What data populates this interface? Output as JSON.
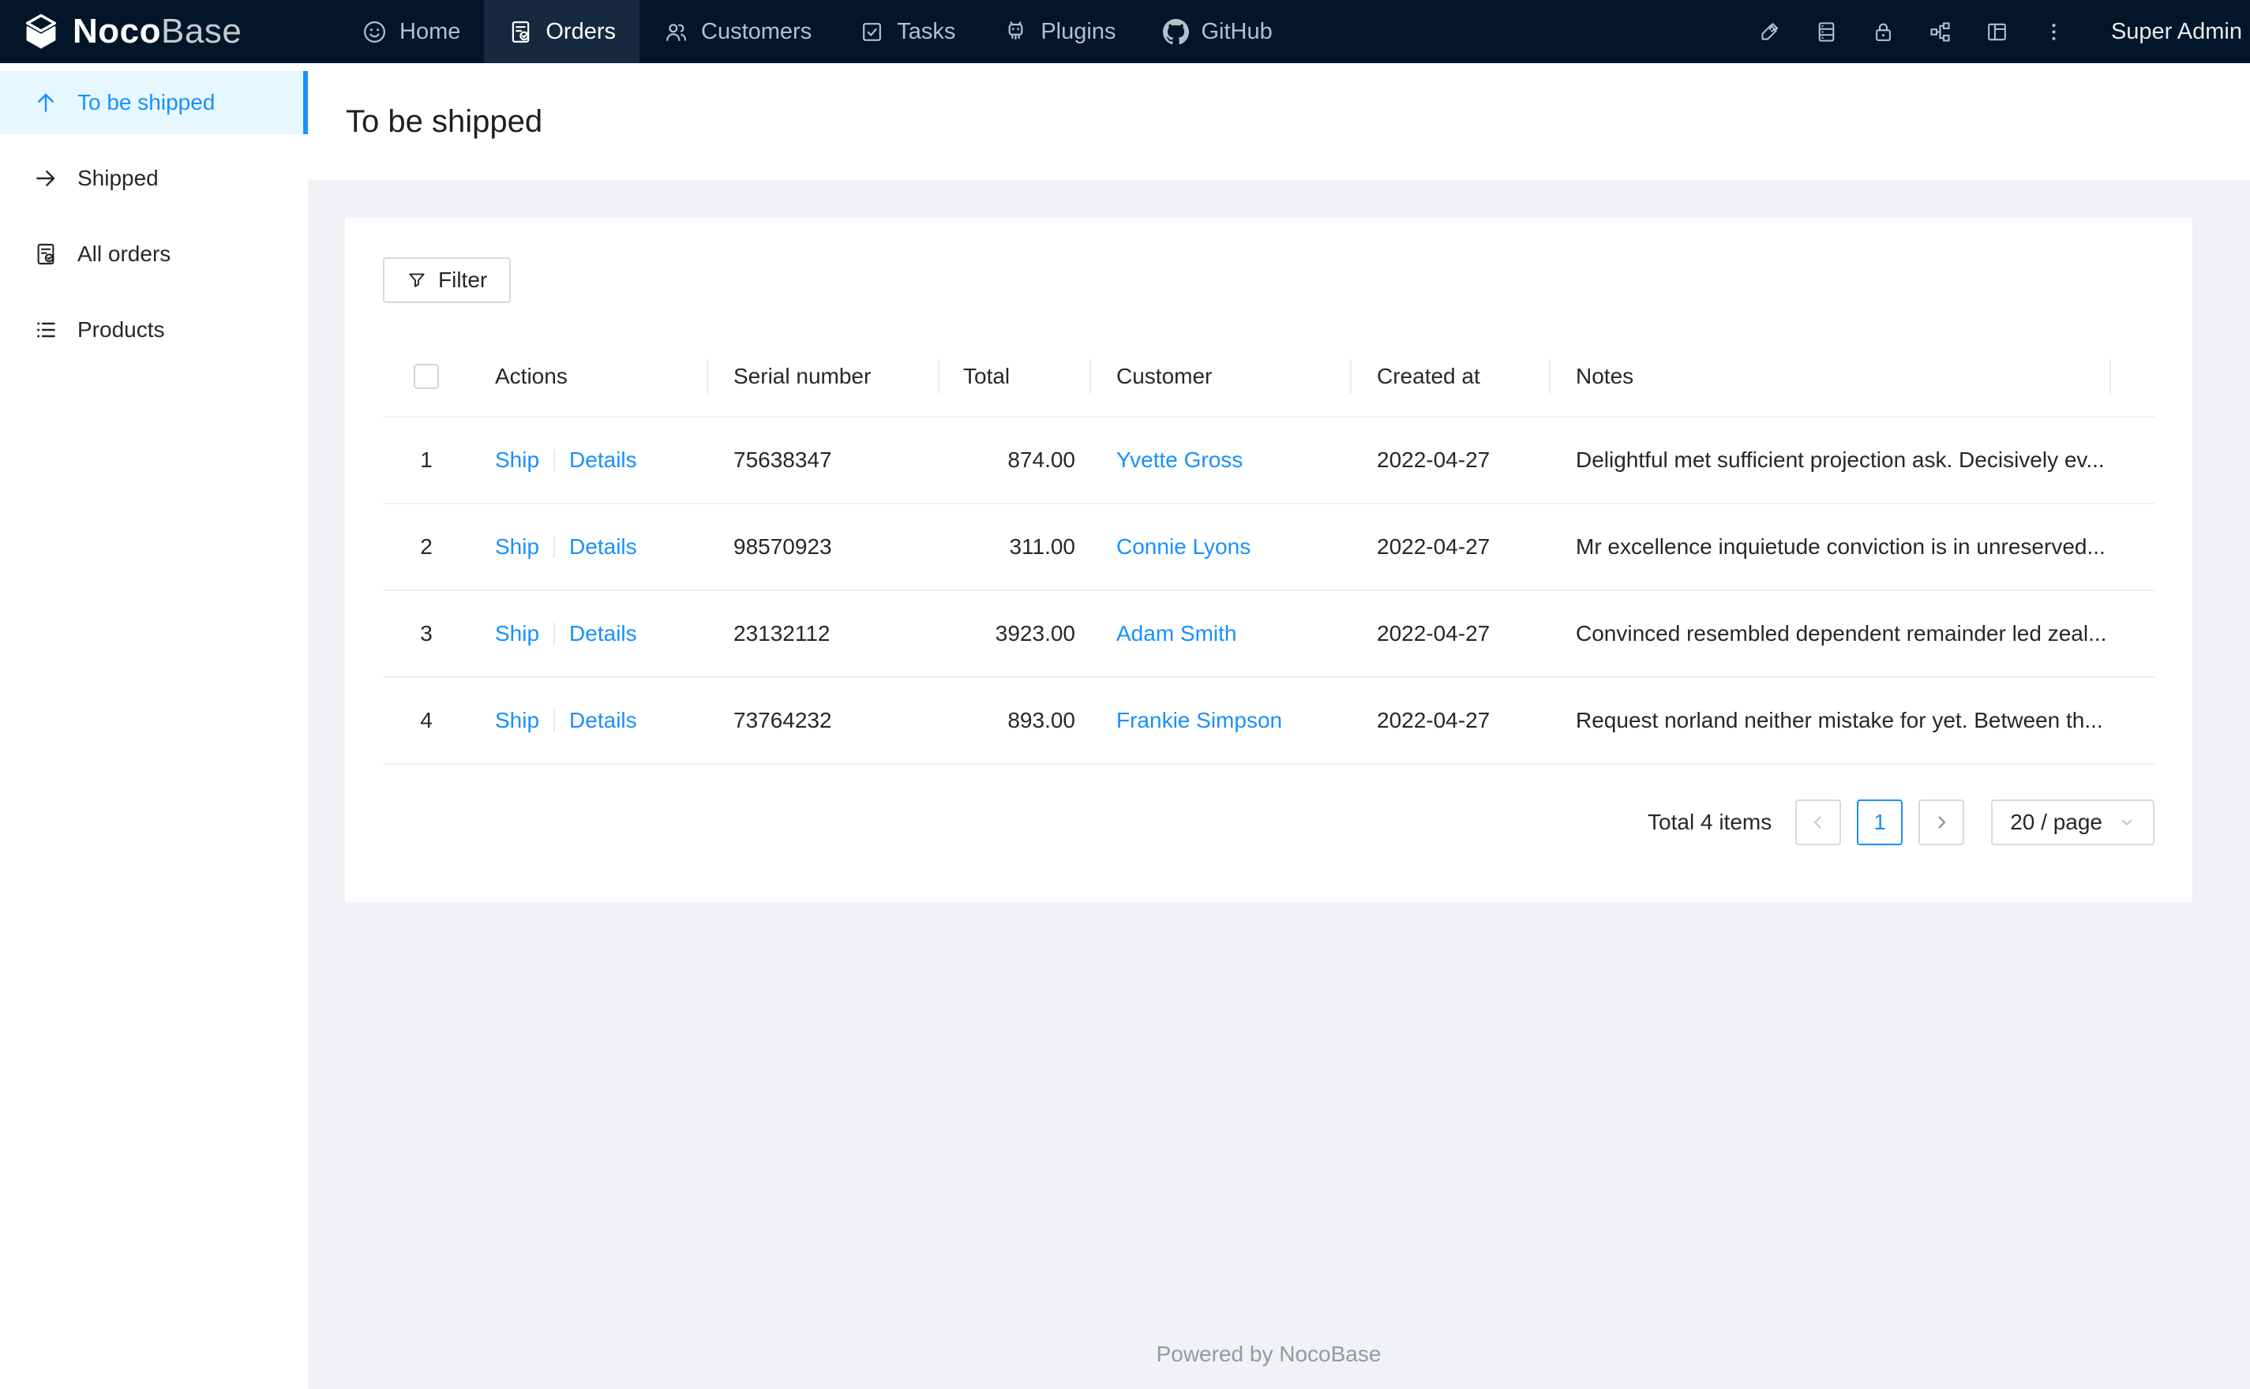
{
  "brand": {
    "name_bold": "Noco",
    "name_light": "Base"
  },
  "nav": {
    "items": [
      {
        "label": "Home",
        "icon": "smiley-icon",
        "active": false
      },
      {
        "label": "Orders",
        "icon": "order-document-icon",
        "active": true
      },
      {
        "label": "Customers",
        "icon": "people-icon",
        "active": false
      },
      {
        "label": "Tasks",
        "icon": "task-checkbox-icon",
        "active": false
      },
      {
        "label": "Plugins",
        "icon": "robot-icon",
        "active": false
      },
      {
        "label": "GitHub",
        "icon": "github-icon",
        "active": false
      }
    ],
    "tools": [
      "highlighter-icon",
      "database-icon",
      "lock-icon",
      "sitemap-icon",
      "layout-icon",
      "ellipsis-icon"
    ],
    "user": "Super Admin"
  },
  "sidebar": {
    "items": [
      {
        "label": "To be shipped",
        "icon": "arrow-up-icon",
        "active": true
      },
      {
        "label": "Shipped",
        "icon": "arrow-right-icon",
        "active": false
      },
      {
        "label": "All orders",
        "icon": "order-document-icon",
        "active": false
      },
      {
        "label": "Products",
        "icon": "unordered-list-icon",
        "active": false
      }
    ]
  },
  "page": {
    "title": "To be shipped"
  },
  "toolbar": {
    "filter_label": "Filter"
  },
  "table": {
    "columns": [
      "Actions",
      "Serial number",
      "Total",
      "Customer",
      "Created at",
      "Notes"
    ],
    "rows": [
      {
        "index": "1",
        "actions": [
          "Ship",
          "Details"
        ],
        "serial": "75638347",
        "total": "874.00",
        "customer": "Yvette Gross",
        "created_at": "2022-04-27",
        "notes": "Delightful met sufficient projection ask. Decisively ev..."
      },
      {
        "index": "2",
        "actions": [
          "Ship",
          "Details"
        ],
        "serial": "98570923",
        "total": "311.00",
        "customer": "Connie Lyons",
        "created_at": "2022-04-27",
        "notes": "Mr excellence inquietude conviction is in unreserved..."
      },
      {
        "index": "3",
        "actions": [
          "Ship",
          "Details"
        ],
        "serial": "23132112",
        "total": "3923.00",
        "customer": "Adam Smith",
        "created_at": "2022-04-27",
        "notes": "Convinced resembled dependent remainder led zeal..."
      },
      {
        "index": "4",
        "actions": [
          "Ship",
          "Details"
        ],
        "serial": "73764232",
        "total": "893.00",
        "customer": "Frankie Simpson",
        "created_at": "2022-04-27",
        "notes": "Request norland neither mistake for yet. Between th..."
      }
    ]
  },
  "pagination": {
    "total_text": "Total 4 items",
    "current_page": "1",
    "page_size": "20 / page"
  },
  "footer": {
    "text": "Powered by NocoBase"
  },
  "colors": {
    "accent": "#1890ff",
    "nav_bg": "#021529",
    "nav_active_bg": "#16293f",
    "sidebar_active_bg": "#e6f7ff",
    "page_bg": "#f0f2f5",
    "border": "#f0f0f0"
  }
}
